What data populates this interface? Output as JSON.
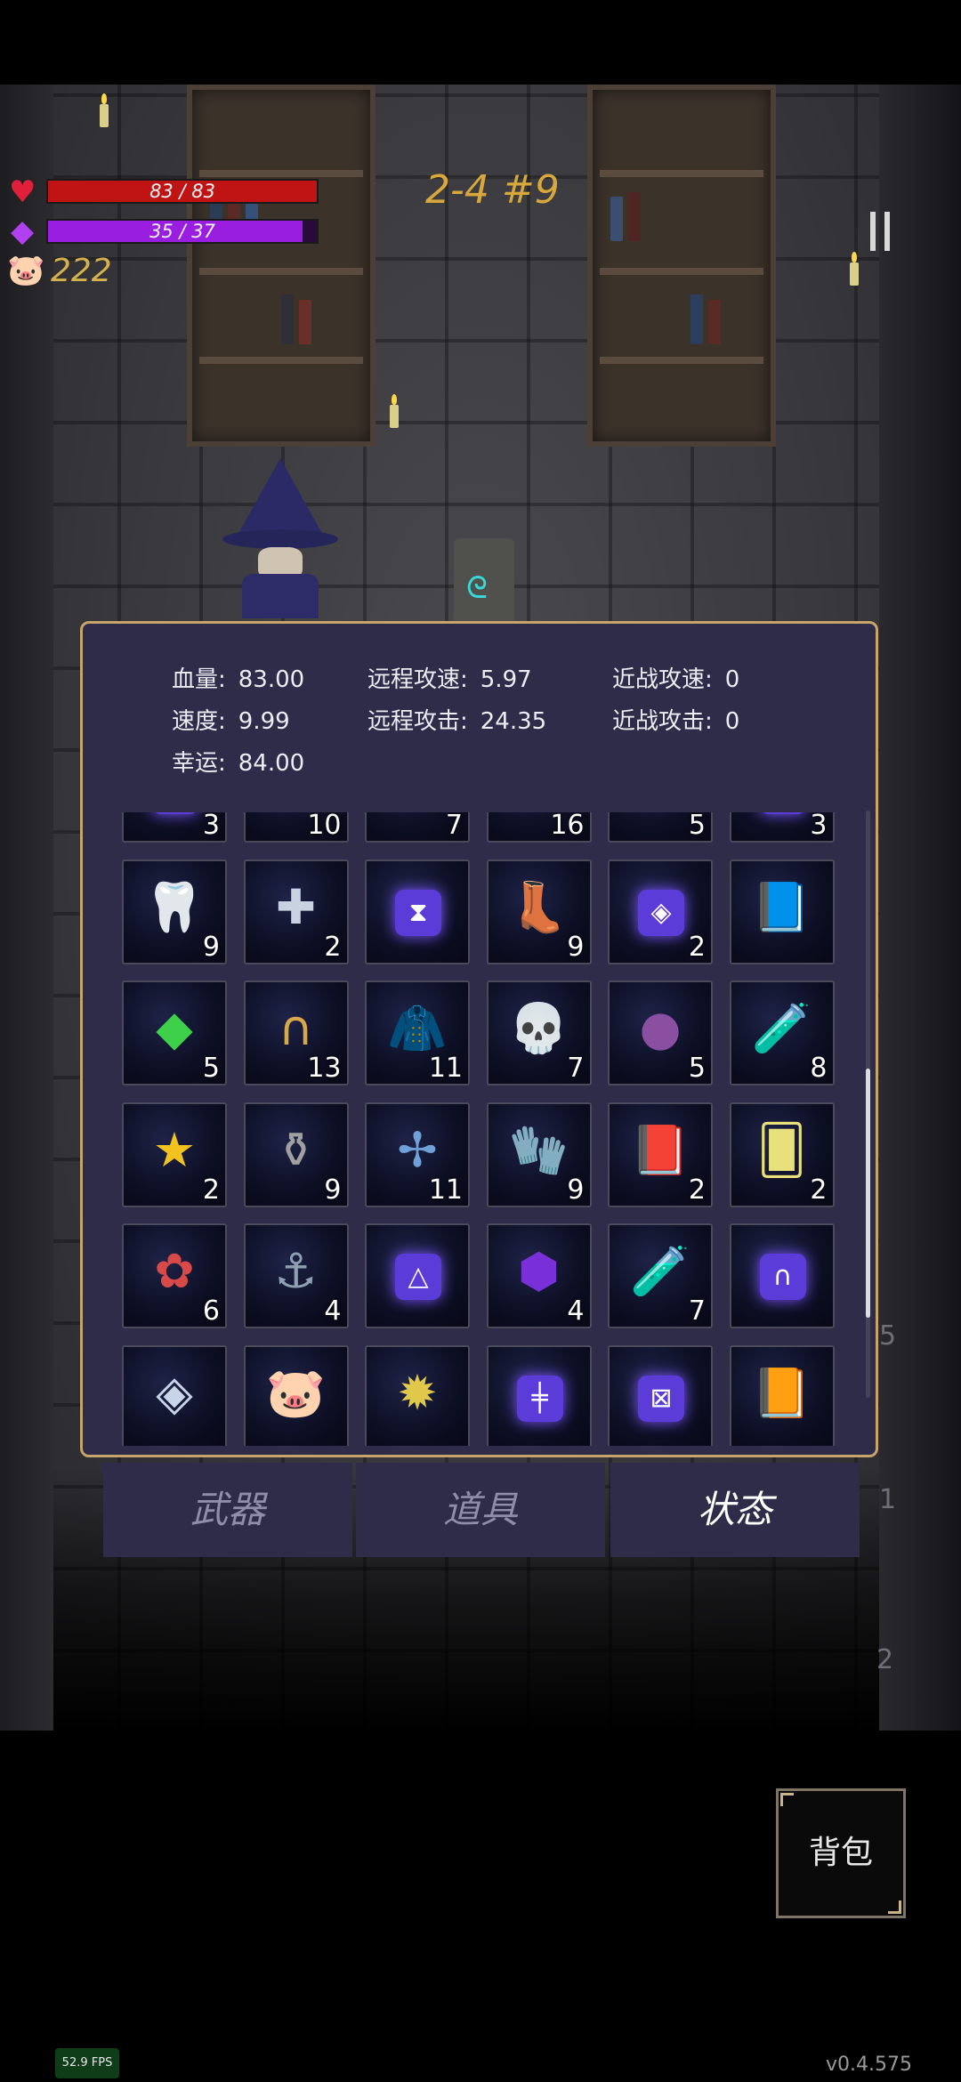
{
  "hud": {
    "hp_text": "83 / 83",
    "hp_fraction": 1.0,
    "mp_text": "35 / 37",
    "mp_fraction": 0.946,
    "coins": "222",
    "stage": "2-4 #9"
  },
  "colors": {
    "hp": "#c01414",
    "mp": "#9a1ee0",
    "panel_border": "#c7a46a",
    "stage_text": "#d8a83c"
  },
  "stats": {
    "hp_label": "血量:",
    "hp_value": "83.00",
    "ranged_speed_label": "远程攻速:",
    "ranged_speed_value": "5.97",
    "melee_speed_label": "近战攻速:",
    "melee_speed_value": "0",
    "speed_label": "速度:",
    "speed_value": "9.99",
    "ranged_attack_label": "远程攻击:",
    "ranged_attack_value": "24.35",
    "melee_attack_label": "近战攻击:",
    "melee_attack_value": "0",
    "luck_label": "幸运:",
    "luck_value": "84.00"
  },
  "items": [
    {
      "icon": "spiral-rune",
      "count": "3"
    },
    {
      "icon": "boots",
      "count": "10"
    },
    {
      "icon": "stone",
      "count": "7"
    },
    {
      "icon": "red-crystal",
      "count": "16"
    },
    {
      "icon": "feather",
      "count": "5"
    },
    {
      "icon": "spiral-rune",
      "count": "3"
    },
    {
      "icon": "horn",
      "count": "9"
    },
    {
      "icon": "holy-ring",
      "count": "2"
    },
    {
      "icon": "hourglass-rune",
      "count": ""
    },
    {
      "icon": "purple-boots",
      "count": "9"
    },
    {
      "icon": "eye-rune",
      "count": "2"
    },
    {
      "icon": "spell-book",
      "count": ""
    },
    {
      "icon": "green-crystal",
      "count": "5"
    },
    {
      "icon": "horseshoe",
      "count": "13"
    },
    {
      "icon": "cloak",
      "count": "11"
    },
    {
      "icon": "feather-skull",
      "count": "7"
    },
    {
      "icon": "purple-slime",
      "count": "5"
    },
    {
      "icon": "blue-potion",
      "count": "8"
    },
    {
      "icon": "star-trophy",
      "count": "2"
    },
    {
      "icon": "small-flask",
      "count": "9"
    },
    {
      "icon": "dragonfly",
      "count": "11"
    },
    {
      "icon": "gloves",
      "count": "9"
    },
    {
      "icon": "fire-book",
      "count": "2"
    },
    {
      "icon": "yellow-card",
      "count": "2"
    },
    {
      "icon": "red-flower",
      "count": "6"
    },
    {
      "icon": "hook",
      "count": "4"
    },
    {
      "icon": "triangle-rune",
      "count": ""
    },
    {
      "icon": "purple-gem",
      "count": "4"
    },
    {
      "icon": "green-potion",
      "count": "7"
    },
    {
      "icon": "arc-rune",
      "count": ""
    },
    {
      "icon": "dice",
      "count": ""
    },
    {
      "icon": "piggy-bank",
      "count": ""
    },
    {
      "icon": "star-fruit",
      "count": ""
    },
    {
      "icon": "cross-rune",
      "count": ""
    },
    {
      "icon": "x-rune",
      "count": ""
    },
    {
      "icon": "skull-book",
      "count": ""
    }
  ],
  "tabs": [
    {
      "label": "武器",
      "active": false
    },
    {
      "label": "道具",
      "active": false
    },
    {
      "label": "状态",
      "active": true
    }
  ],
  "bag_label": "背包",
  "fps": "52.9 FPS",
  "version": "v0.4.575",
  "side_numbers": [
    "5",
    "1",
    "2"
  ]
}
